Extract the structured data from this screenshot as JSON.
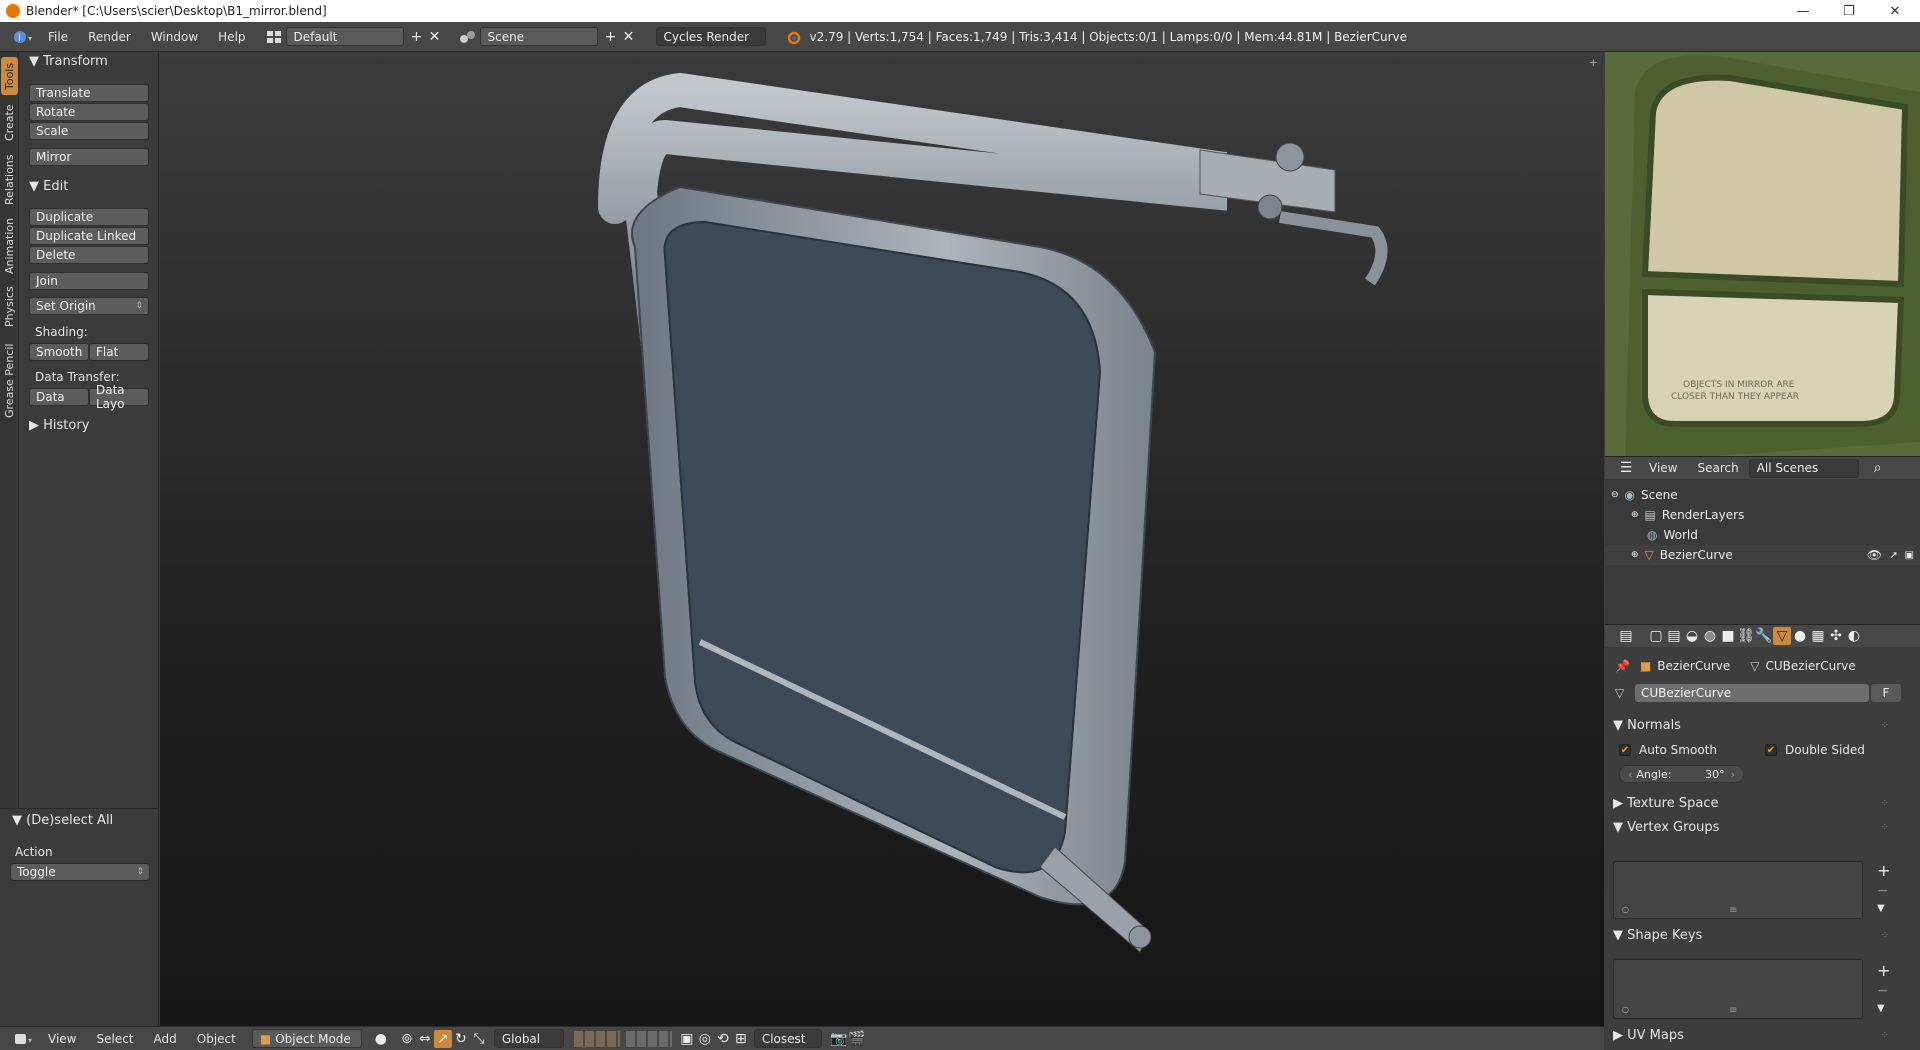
{
  "window": {
    "title": "Blender* [C:\\Users\\scier\\Desktop\\B1_mirror.blend]",
    "minimize": "—",
    "maximize": "❐",
    "close": "✕"
  },
  "info_header": {
    "menus": [
      "File",
      "Render",
      "Window",
      "Help"
    ],
    "screen_layout": "Default",
    "scene": "Scene",
    "render_engine": "Cycles Render",
    "stats": "v2.79 | Verts:1,754 | Faces:1,749 | Tris:3,414 | Objects:0/1 | Lamps:0/0 | Mem:44.81M | BezierCurve"
  },
  "tool_tabs": [
    "Tools",
    "Create",
    "Relations",
    "Animation",
    "Physics",
    "Grease Pencil"
  ],
  "toolshelf": {
    "transform_header": "Transform",
    "translate": "Translate",
    "rotate": "Rotate",
    "scale": "Scale",
    "mirror": "Mirror",
    "edit_header": "Edit",
    "duplicate": "Duplicate",
    "duplicate_linked": "Duplicate Linked",
    "delete": "Delete",
    "join": "Join",
    "set_origin": "Set Origin",
    "shading_label": "Shading:",
    "smooth": "Smooth",
    "flat": "Flat",
    "data_transfer_label": "Data Transfer:",
    "data": "Data",
    "data_layo": "Data Layo",
    "history_header": "History"
  },
  "operator_panel": {
    "header": "(De)select All",
    "action_label": "Action",
    "action_value": "Toggle"
  },
  "bottom_header": {
    "menus": [
      "View",
      "Select",
      "Add",
      "Object"
    ],
    "mode": "Object Mode",
    "orientation": "Global",
    "snap": "Closest"
  },
  "outliner": {
    "view": "View",
    "search": "Search",
    "display": "All Scenes",
    "items": [
      "Scene",
      "RenderLayers",
      "World",
      "BezierCurve"
    ]
  },
  "properties": {
    "breadcrumb_object": "BezierCurve",
    "breadcrumb_data": "CUBezierCurve",
    "datablock_name": "CUBezierCurve",
    "fake_user": "F",
    "normals_header": "Normals",
    "auto_smooth": "Auto Smooth",
    "double_sided": "Double Sided",
    "angle_label": "Angle:",
    "angle_value": "30°",
    "texture_space_header": "Texture Space",
    "vertex_groups_header": "Vertex Groups",
    "shape_keys_header": "Shape Keys",
    "uv_maps_header": "UV Maps"
  },
  "reference_image": {
    "line1": "OBJECTS IN MIRROR ARE",
    "line2": "CLOSER THAN THEY APPEAR"
  },
  "colors": {
    "accent": "#cc8a3a",
    "checkbox_check": "#f5a020",
    "mirror_glass": "#3d4a56",
    "mirror_frame": "#9aa0a8"
  }
}
